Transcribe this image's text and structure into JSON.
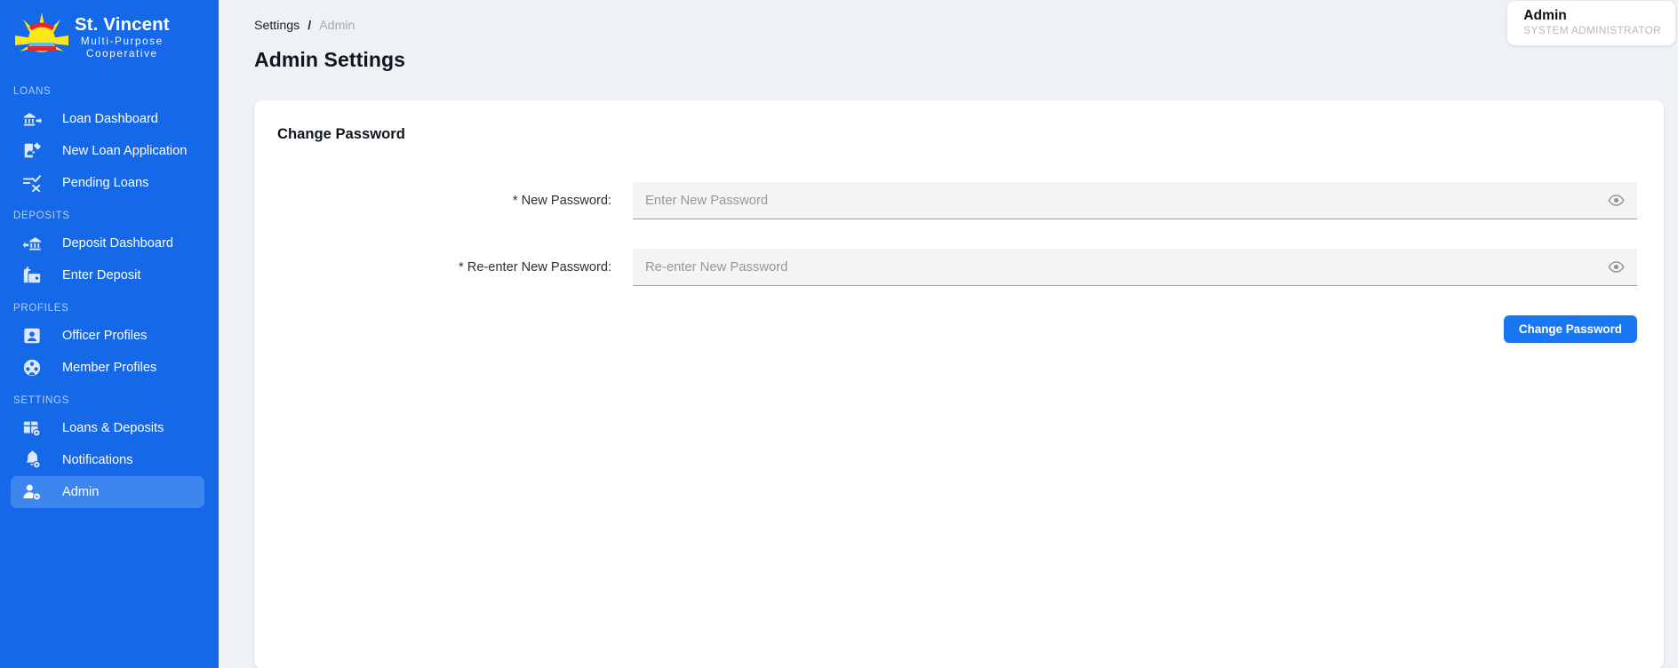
{
  "brand": {
    "name": "St. Vincent",
    "line1": "Multi-Purpose",
    "line2": "Cooperative",
    "logo_icon": "sun-logo-icon"
  },
  "sidebar": {
    "sections": [
      {
        "label": "LOANS",
        "items": [
          {
            "label": "Loan Dashboard",
            "icon": "bank-arrow-icon",
            "active": false
          },
          {
            "label": "New Loan Application",
            "icon": "document-pen-icon",
            "active": false
          },
          {
            "label": "Pending Loans",
            "icon": "checklist-x-icon",
            "active": false
          }
        ]
      },
      {
        "label": "DEPOSITS",
        "items": [
          {
            "label": "Deposit Dashboard",
            "icon": "arrow-bank-icon",
            "active": false
          },
          {
            "label": "Enter Deposit",
            "icon": "wallet-plus-icon",
            "active": false
          }
        ]
      },
      {
        "label": "PROFILES",
        "items": [
          {
            "label": "Officer Profiles",
            "icon": "id-badge-icon",
            "active": false
          },
          {
            "label": "Member Profiles",
            "icon": "group-circle-icon",
            "active": false
          }
        ]
      },
      {
        "label": "SETTINGS",
        "items": [
          {
            "label": "Loans & Deposits",
            "icon": "grid-gear-icon",
            "active": false
          },
          {
            "label": "Notifications",
            "icon": "bell-gear-icon",
            "active": false
          },
          {
            "label": "Admin",
            "icon": "person-gear-icon",
            "active": true
          }
        ]
      }
    ]
  },
  "breadcrumb": {
    "current": "Settings",
    "separator": "/",
    "next": "Admin"
  },
  "page": {
    "title": "Admin Settings"
  },
  "user": {
    "name": "Admin",
    "role": "SYSTEM ADMINISTRATOR"
  },
  "change_password": {
    "card_title": "Change Password",
    "fields": [
      {
        "label": "* New Password:",
        "placeholder": "Enter New Password",
        "value": "",
        "toggle_icon": "eye-icon"
      },
      {
        "label": "* Re-enter New Password:",
        "placeholder": "Re-enter New Password",
        "value": "",
        "toggle_icon": "eye-icon"
      }
    ],
    "submit_label": "Change Password"
  },
  "colors": {
    "sidebar_blue": "#1568e8",
    "active_item_blue": "#3d86f0",
    "primary_button": "#1877f2",
    "page_background": "#eef2f6"
  }
}
